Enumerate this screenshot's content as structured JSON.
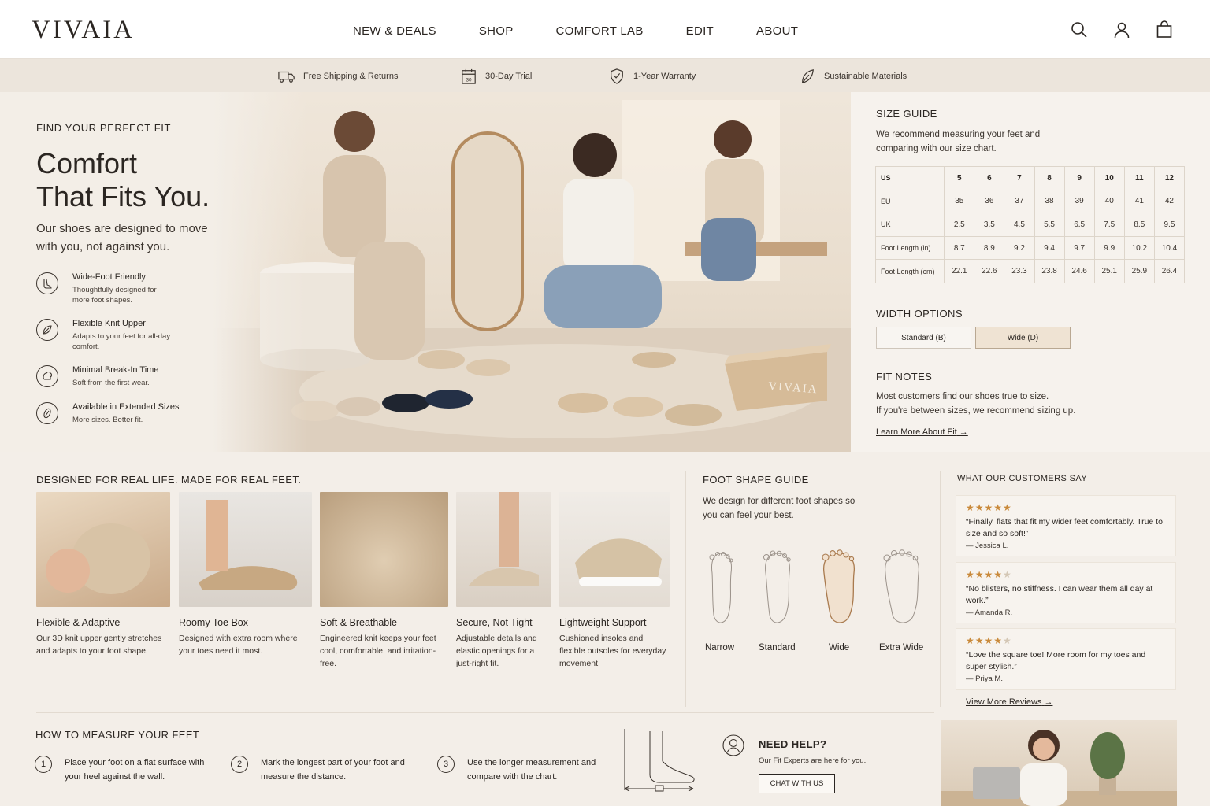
{
  "brand": {
    "logo": "VIVAIA"
  },
  "nav": [
    "NEW & DEALS",
    "SHOP",
    "COMFORT LAB",
    "EDIT",
    "ABOUT"
  ],
  "header_icons": [
    "search-icon",
    "account-icon",
    "bag-icon"
  ],
  "perks": [
    {
      "label": "Free Shipping & Returns",
      "icon": "truck-icon"
    },
    {
      "label": "30-Day Trial",
      "icon": "calendar-icon",
      "badge": "30"
    },
    {
      "label": "1-Year Warranty",
      "icon": "shield-icon"
    },
    {
      "label": "Sustainable Materials",
      "icon": "leaf-icon"
    }
  ],
  "hero": {
    "eyebrow": "FIND YOUR PERFECT FIT",
    "title_line1": "Comfort",
    "title_line2": "That Fits You.",
    "subtitle": "Our shoes are designed to move with you, not against you.",
    "box_brand": "VIVAIA",
    "features": [
      {
        "title": "Wide-Foot Friendly",
        "text": "Thoughtfully designed for more foot shapes."
      },
      {
        "title": "Flexible Knit Upper",
        "text": "Adapts to your feet for all-day comfort."
      },
      {
        "title": "Minimal Break-In Time",
        "text": "Soft from the first wear."
      },
      {
        "title": "Available in Extended Sizes",
        "text": "More sizes. Better fit."
      }
    ]
  },
  "size_guide": {
    "title": "SIZE GUIDE",
    "intro": "We recommend measuring your feet and comparing with our size chart.",
    "rows": [
      {
        "label": "US",
        "values": [
          "5",
          "6",
          "7",
          "8",
          "9",
          "10",
          "11",
          "12"
        ]
      },
      {
        "label": "EU",
        "values": [
          "35",
          "36",
          "37",
          "38",
          "39",
          "40",
          "41",
          "42"
        ]
      },
      {
        "label": "UK",
        "values": [
          "2.5",
          "3.5",
          "4.5",
          "5.5",
          "6.5",
          "7.5",
          "8.5",
          "9.5"
        ]
      },
      {
        "label": "Foot Length (in)",
        "values": [
          "8.7",
          "8.9",
          "9.2",
          "9.4",
          "9.7",
          "9.9",
          "10.2",
          "10.4"
        ]
      },
      {
        "label": "Foot Length (cm)",
        "values": [
          "22.1",
          "22.6",
          "23.3",
          "23.8",
          "24.6",
          "25.1",
          "25.9",
          "26.4"
        ]
      }
    ],
    "width_title": "WIDTH OPTIONS",
    "width_options": [
      "Standard (B)",
      "Wide (D)"
    ],
    "width_selected": "Wide (D)",
    "fit_title": "FIT NOTES",
    "fit_line1": "Most customers find our shoes true to size.",
    "fit_line2": "If you're between sizes, we recommend sizing up.",
    "learn_more": "Learn More About Fit"
  },
  "designed": {
    "title": "DESIGNED FOR REAL LIFE. MADE FOR REAL FEET.",
    "cards": [
      {
        "title": "Flexible & Adaptive",
        "text": "Our 3D knit upper gently stretches and adapts to your foot shape."
      },
      {
        "title": "Roomy Toe Box",
        "text": "Designed with extra room where your toes need it most."
      },
      {
        "title": "Soft & Breathable",
        "text": "Engineered knit keeps your feet cool, comfortable, and irritation-free."
      },
      {
        "title": "Secure, Not Tight",
        "text": "Adjustable details and elastic openings for a just-right fit."
      },
      {
        "title": "Lightweight Support",
        "text": "Cushioned insoles and flexible outsoles for everyday movement."
      }
    ]
  },
  "foot_shape": {
    "title": "FOOT SHAPE GUIDE",
    "intro": "We design for different foot shapes so you can feel your best.",
    "shapes": [
      "Narrow",
      "Standard",
      "Wide",
      "Extra Wide"
    ],
    "highlighted": "Wide"
  },
  "reviews": {
    "title": "WHAT OUR CUSTOMERS SAY",
    "items": [
      {
        "rating": 5,
        "quote": "“Finally, flats that fit my wider feet comfortably. True to size and so soft!”",
        "author": "— Jessica L."
      },
      {
        "rating": 4,
        "quote": "“No blisters, no stiffness. I can wear them all day at work.”",
        "author": "— Amanda R."
      },
      {
        "rating": 4,
        "quote": "“Love the square toe! More room for my toes and super stylish.”",
        "author": "— Priya M."
      }
    ],
    "view_more": "View More Reviews"
  },
  "measure": {
    "title": "HOW TO MEASURE YOUR FEET",
    "steps": [
      {
        "n": "1",
        "text": "Place your foot on a flat surface with your heel against the wall."
      },
      {
        "n": "2",
        "text": "Mark the longest part of your foot and measure the distance."
      },
      {
        "n": "3",
        "text": "Use the longer measurement and compare with the chart."
      }
    ]
  },
  "help": {
    "title": "NEED HELP?",
    "text": "Our Fit Experts are here for you.",
    "button": "CHAT WITH US"
  },
  "colors": {
    "accent": "#c9893a",
    "background": "#f3eee8",
    "text": "#2b2622",
    "highlight_foot": "#a97a4e"
  }
}
